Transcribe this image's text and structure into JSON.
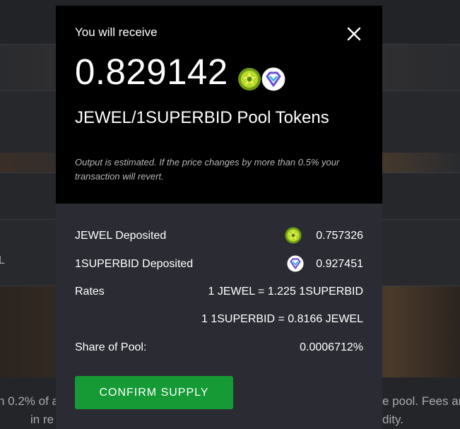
{
  "background": {
    "left_text_1": "n 0.2% of a",
    "left_text_2": "in re",
    "right_text_1": "e pool. Fees ar",
    "right_text_2": "dity.",
    "edge_letter": "L"
  },
  "modal": {
    "title": "You will receive",
    "amount": "0.829142",
    "pool_tokens": "JEWEL/1SUPERBID Pool Tokens",
    "note": "Output is estimated. If the price changes by more than 0.5% your transaction will revert.",
    "rows": {
      "jewel_label": "JEWEL Deposited",
      "jewel_value": "0.757326",
      "superbid_label": "1SUPERBID Deposited",
      "superbid_value": "0.927451",
      "rates_label": "Rates",
      "rate_1": "1 JEWEL = 1.225 1SUPERBID",
      "rate_2": "1 1SUPERBID = 0.8166 JEWEL",
      "share_label": "Share of Pool:",
      "share_value": "0.0006712%"
    },
    "confirm_label": "CONFIRM SUPPLY"
  },
  "icons": {
    "close": "close-icon",
    "jewel": "jewel-token-icon",
    "superbid": "superbid-token-icon"
  },
  "colors": {
    "confirm_button": "#159a35",
    "modal_top": "#000000",
    "modal_bottom": "#2b2c33"
  }
}
